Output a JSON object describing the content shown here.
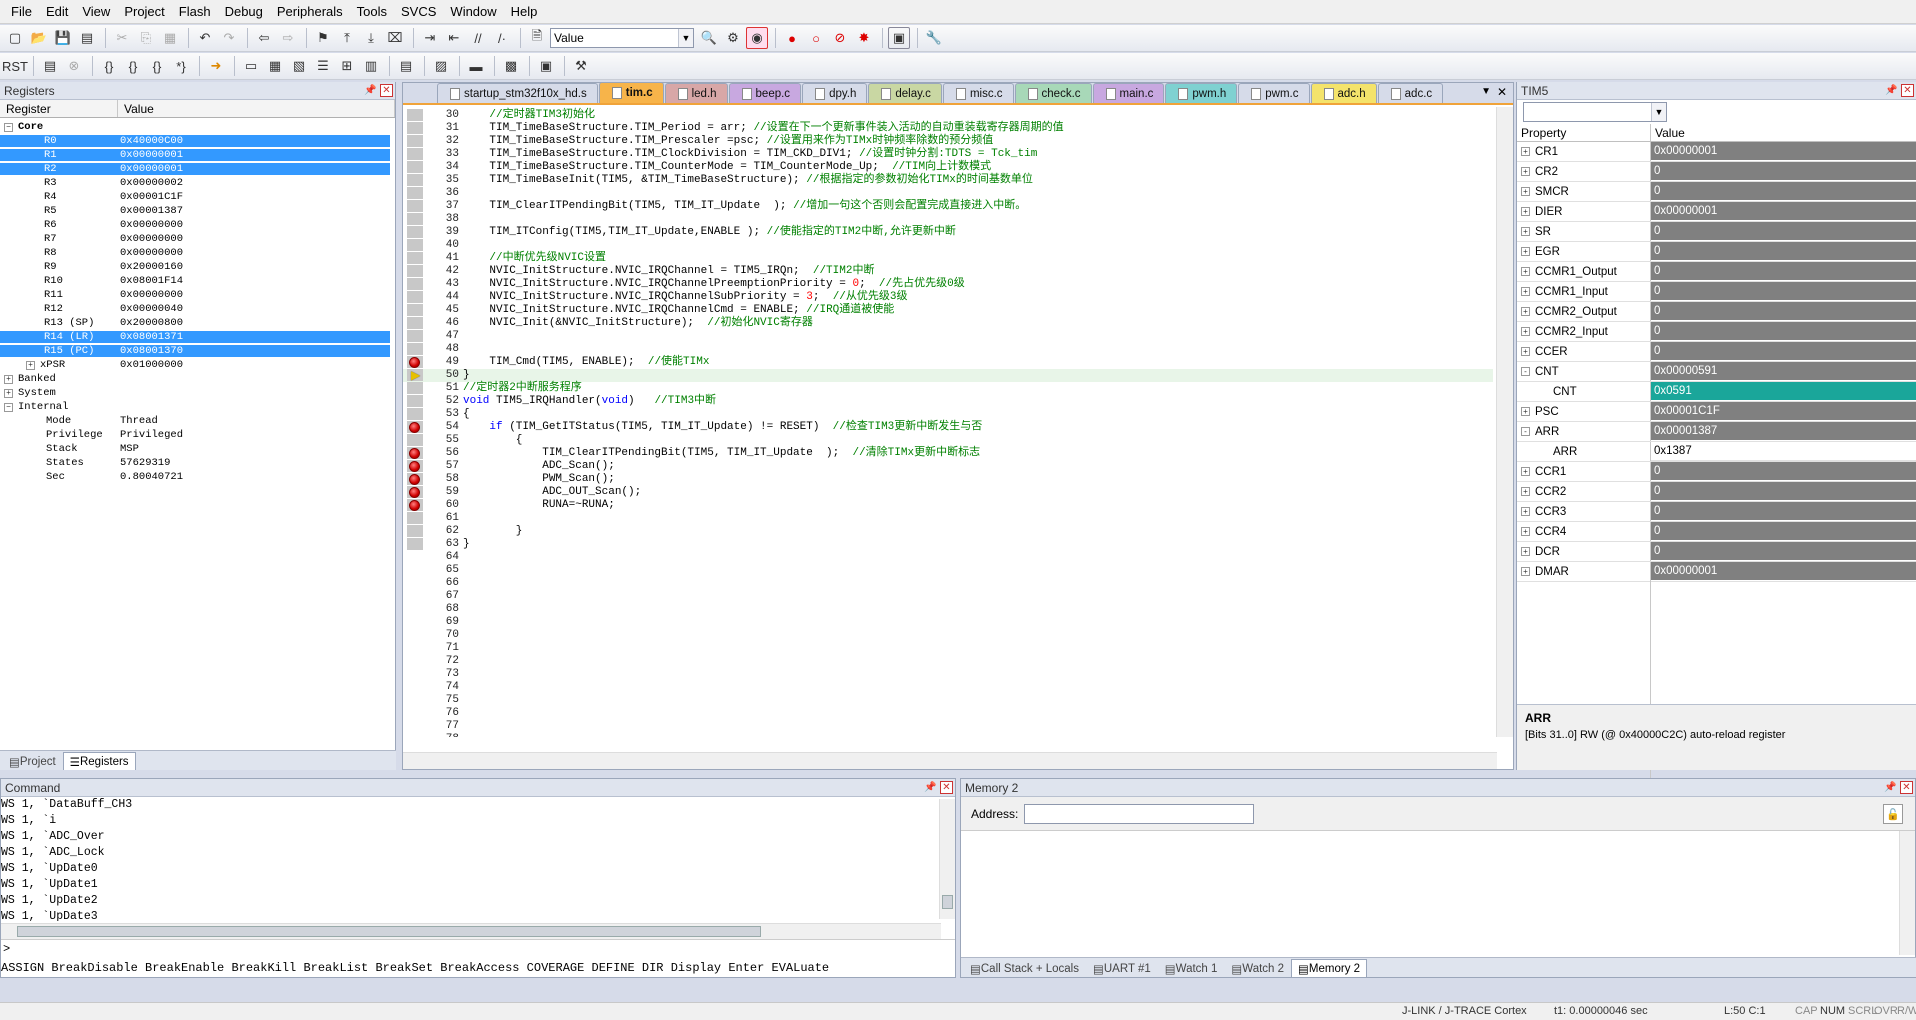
{
  "menu": [
    "File",
    "Edit",
    "View",
    "Project",
    "Flash",
    "Debug",
    "Peripherals",
    "Tools",
    "SVCS",
    "Window",
    "Help"
  ],
  "toolbar": {
    "find_combo_value": "Value"
  },
  "registers": {
    "title": "Registers",
    "col_register": "Register",
    "col_value": "Value",
    "core_label": "Core",
    "rows": [
      {
        "name": "R0",
        "value": "0x40000C00",
        "sel": true
      },
      {
        "name": "R1",
        "value": "0x00000001",
        "sel": true
      },
      {
        "name": "R2",
        "value": "0x00000001",
        "sel": true
      },
      {
        "name": "R3",
        "value": "0x00000002",
        "sel": false
      },
      {
        "name": "R4",
        "value": "0x00001C1F",
        "sel": false
      },
      {
        "name": "R5",
        "value": "0x00001387",
        "sel": false
      },
      {
        "name": "R6",
        "value": "0x00000000",
        "sel": false
      },
      {
        "name": "R7",
        "value": "0x00000000",
        "sel": false
      },
      {
        "name": "R8",
        "value": "0x00000000",
        "sel": false
      },
      {
        "name": "R9",
        "value": "0x20000160",
        "sel": false
      },
      {
        "name": "R10",
        "value": "0x08001F14",
        "sel": false
      },
      {
        "name": "R11",
        "value": "0x00000000",
        "sel": false
      },
      {
        "name": "R12",
        "value": "0x00000040",
        "sel": false
      },
      {
        "name": "R13 (SP)",
        "value": "0x20000800",
        "sel": false
      },
      {
        "name": "R14 (LR)",
        "value": "0x08001371",
        "sel": true
      },
      {
        "name": "R15 (PC)",
        "value": "0x08001370",
        "sel": true
      },
      {
        "name": "xPSR",
        "value": "0x01000000",
        "sel": false
      }
    ],
    "groups": [
      "Banked",
      "System",
      "Internal"
    ],
    "internal": [
      {
        "name": "Mode",
        "value": "Thread"
      },
      {
        "name": "Privilege",
        "value": "Privileged"
      },
      {
        "name": "Stack",
        "value": "MSP"
      },
      {
        "name": "States",
        "value": "57629319"
      },
      {
        "name": "Sec",
        "value": "0.80040721"
      }
    ],
    "tabs": [
      "Project",
      "Registers"
    ]
  },
  "editor": {
    "tabs": [
      "startup_stm32f10x_hd.s",
      "tim.c",
      "led.h",
      "beep.c",
      "dpy.h",
      "delay.c",
      "misc.c",
      "check.c",
      "main.c",
      "pwm.h",
      "pwm.c",
      "adc.h",
      "adc.c"
    ],
    "tab_colors": [
      "#d6dbe9",
      "#f7b44a",
      "#d8a7a7",
      "#c8a8e0",
      "#d6dbe9",
      "#c9d7a3",
      "#d6dbe9",
      "#a8d8b8",
      "#c8a8e0",
      "#7fd1d1",
      "#d6dbe9",
      "#f4e36b",
      "#d6dbe9"
    ],
    "active_tab": 1,
    "lines": [
      {
        "n": "30",
        "t": "    //定时器TIM3初始化"
      },
      {
        "n": "31",
        "t": "    TIM_TimeBaseStructure.TIM_Period = arr; //设置在下一个更新事件装入活动的自动重装载寄存器周期的值"
      },
      {
        "n": "32",
        "t": "    TIM_TimeBaseStructure.TIM_Prescaler =psc; //设置用来作为TIMx时钟频率除数的预分频值"
      },
      {
        "n": "33",
        "t": "    TIM_TimeBaseStructure.TIM_ClockDivision = TIM_CKD_DIV1; //设置时钟分割:TDTS = Tck_tim"
      },
      {
        "n": "34",
        "t": "    TIM_TimeBaseStructure.TIM_CounterMode = TIM_CounterMode_Up;  //TIM向上计数模式"
      },
      {
        "n": "35",
        "t": "    TIM_TimeBaseInit(TIM5, &TIM_TimeBaseStructure); //根据指定的参数初始化TIMx的时间基数单位"
      },
      {
        "n": "36",
        "t": ""
      },
      {
        "n": "37",
        "t": "    TIM_ClearITPendingBit(TIM5, TIM_IT_Update  ); //增加一句这个否则会配置完成直接进入中断。"
      },
      {
        "n": "38",
        "t": ""
      },
      {
        "n": "39",
        "t": "    TIM_ITConfig(TIM5,TIM_IT_Update,ENABLE ); //使能指定的TIM2中断,允许更新中断"
      },
      {
        "n": "40",
        "t": ""
      },
      {
        "n": "41",
        "t": "    //中断优先级NVIC设置"
      },
      {
        "n": "42",
        "t": "    NVIC_InitStructure.NVIC_IRQChannel = TIM5_IRQn;  //TIM2中断"
      },
      {
        "n": "43",
        "t": "    NVIC_InitStructure.NVIC_IRQChannelPreemptionPriority = 0;  //先占优先级0级"
      },
      {
        "n": "44",
        "t": "    NVIC_InitStructure.NVIC_IRQChannelSubPriority = 3;  //从优先级3级"
      },
      {
        "n": "45",
        "t": "    NVIC_InitStructure.NVIC_IRQChannelCmd = ENABLE; //IRQ通道被使能"
      },
      {
        "n": "46",
        "t": "    NVIC_Init(&NVIC_InitStructure);  //初始化NVIC寄存器"
      },
      {
        "n": "47",
        "t": ""
      },
      {
        "n": "48",
        "t": ""
      },
      {
        "n": "49",
        "t": "    TIM_Cmd(TIM5, ENABLE);  //使能TIMx"
      },
      {
        "n": "50",
        "t": "}"
      },
      {
        "n": "51",
        "t": "//定时器2中断服务程序"
      },
      {
        "n": "52",
        "t": "void TIM5_IRQHandler(void)   //TIM3中断"
      },
      {
        "n": "53",
        "t": "{"
      },
      {
        "n": "54",
        "t": "    if (TIM_GetITStatus(TIM5, TIM_IT_Update) != RESET)  //检查TIM3更新中断发生与否"
      },
      {
        "n": "55",
        "t": "        {"
      },
      {
        "n": "56",
        "t": "            TIM_ClearITPendingBit(TIM5, TIM_IT_Update  );  //清除TIMx更新中断标志"
      },
      {
        "n": "57",
        "t": "            ADC_Scan();"
      },
      {
        "n": "58",
        "t": "            PWM_Scan();"
      },
      {
        "n": "59",
        "t": "            ADC_OUT_Scan();"
      },
      {
        "n": "60",
        "t": "            RUNA=~RUNA;"
      },
      {
        "n": "61",
        "t": ""
      },
      {
        "n": "62",
        "t": "        }"
      },
      {
        "n": "63",
        "t": "}"
      },
      {
        "n": "64",
        "t": ""
      },
      {
        "n": "65",
        "t": ""
      },
      {
        "n": "66",
        "t": ""
      },
      {
        "n": "67",
        "t": ""
      },
      {
        "n": "68",
        "t": ""
      },
      {
        "n": "69",
        "t": ""
      },
      {
        "n": "70",
        "t": ""
      },
      {
        "n": "71",
        "t": ""
      },
      {
        "n": "72",
        "t": ""
      },
      {
        "n": "73",
        "t": ""
      },
      {
        "n": "74",
        "t": ""
      },
      {
        "n": "75",
        "t": ""
      },
      {
        "n": "76",
        "t": ""
      },
      {
        "n": "77",
        "t": ""
      },
      {
        "n": "78",
        "t": ""
      }
    ],
    "breakpoints": [
      "49",
      "54",
      "56",
      "57",
      "58",
      "59",
      "60"
    ],
    "current_line": "50"
  },
  "tim5": {
    "title": "TIM5",
    "col_property": "Property",
    "col_value": "Value",
    "rows": [
      {
        "name": "CR1",
        "value": "0x00000001",
        "exp": "+",
        "indent": 0,
        "style": ""
      },
      {
        "name": "CR2",
        "value": "0",
        "exp": "+",
        "indent": 0,
        "style": ""
      },
      {
        "name": "SMCR",
        "value": "0",
        "exp": "+",
        "indent": 0,
        "style": ""
      },
      {
        "name": "DIER",
        "value": "0x00000001",
        "exp": "+",
        "indent": 0,
        "style": ""
      },
      {
        "name": "SR",
        "value": "0",
        "exp": "+",
        "indent": 0,
        "style": ""
      },
      {
        "name": "EGR",
        "value": "0",
        "exp": "+",
        "indent": 0,
        "style": ""
      },
      {
        "name": "CCMR1_Output",
        "value": "0",
        "exp": "+",
        "indent": 0,
        "style": ""
      },
      {
        "name": "CCMR1_Input",
        "value": "0",
        "exp": "+",
        "indent": 0,
        "style": ""
      },
      {
        "name": "CCMR2_Output",
        "value": "0",
        "exp": "+",
        "indent": 0,
        "style": ""
      },
      {
        "name": "CCMR2_Input",
        "value": "0",
        "exp": "+",
        "indent": 0,
        "style": ""
      },
      {
        "name": "CCER",
        "value": "0",
        "exp": "+",
        "indent": 0,
        "style": ""
      },
      {
        "name": "CNT",
        "value": "0x00000591",
        "exp": "-",
        "indent": 0,
        "style": ""
      },
      {
        "name": "CNT",
        "value": "0x0591",
        "exp": "",
        "indent": 1,
        "style": "hl"
      },
      {
        "name": "PSC",
        "value": "0x00001C1F",
        "exp": "+",
        "indent": 0,
        "style": ""
      },
      {
        "name": "ARR",
        "value": "0x00001387",
        "exp": "-",
        "indent": 0,
        "style": ""
      },
      {
        "name": "ARR",
        "value": "0x1387",
        "exp": "",
        "indent": 1,
        "style": "wt"
      },
      {
        "name": "CCR1",
        "value": "0",
        "exp": "+",
        "indent": 0,
        "style": ""
      },
      {
        "name": "CCR2",
        "value": "0",
        "exp": "+",
        "indent": 0,
        "style": ""
      },
      {
        "name": "CCR3",
        "value": "0",
        "exp": "+",
        "indent": 0,
        "style": ""
      },
      {
        "name": "CCR4",
        "value": "0",
        "exp": "+",
        "indent": 0,
        "style": ""
      },
      {
        "name": "DCR",
        "value": "0",
        "exp": "+",
        "indent": 0,
        "style": ""
      },
      {
        "name": "DMAR",
        "value": "0x00000001",
        "exp": "+",
        "indent": 0,
        "style": ""
      }
    ],
    "desc_title": "ARR",
    "desc_text": "[Bits 31..0] RW (@ 0x40000C2C) auto-reload register"
  },
  "command": {
    "title": "Command",
    "lines": [
      "WS 1, `DataBuff_CH3",
      "WS 1, `i",
      "WS 1, `ADC_Over",
      "WS 1, `ADC_Lock",
      "WS 1, `UpDate0",
      "WS 1, `UpDate1",
      "WS 1, `UpDate2",
      "WS 1, `UpDate3"
    ],
    "prompt": ">",
    "help": "ASSIGN BreakDisable BreakEnable BreakKill BreakList BreakSet BreakAccess COVERAGE DEFINE DIR Display Enter EVALuate"
  },
  "memory": {
    "title": "Memory 2",
    "address_label": "Address:",
    "address_value": "",
    "tabs": [
      "Call Stack + Locals",
      "UART #1",
      "Watch 1",
      "Watch 2",
      "Memory 2"
    ],
    "active_tab": 4
  },
  "status": {
    "debugger": "J-LINK / J-TRACE Cortex",
    "time": "t1: 0.00000046 sec",
    "pos": "L:50 C:1",
    "caps": "CAP",
    "num": "NUM",
    "scrl": "SCRL",
    "ovr": "OVR",
    "rw": "R/W"
  }
}
